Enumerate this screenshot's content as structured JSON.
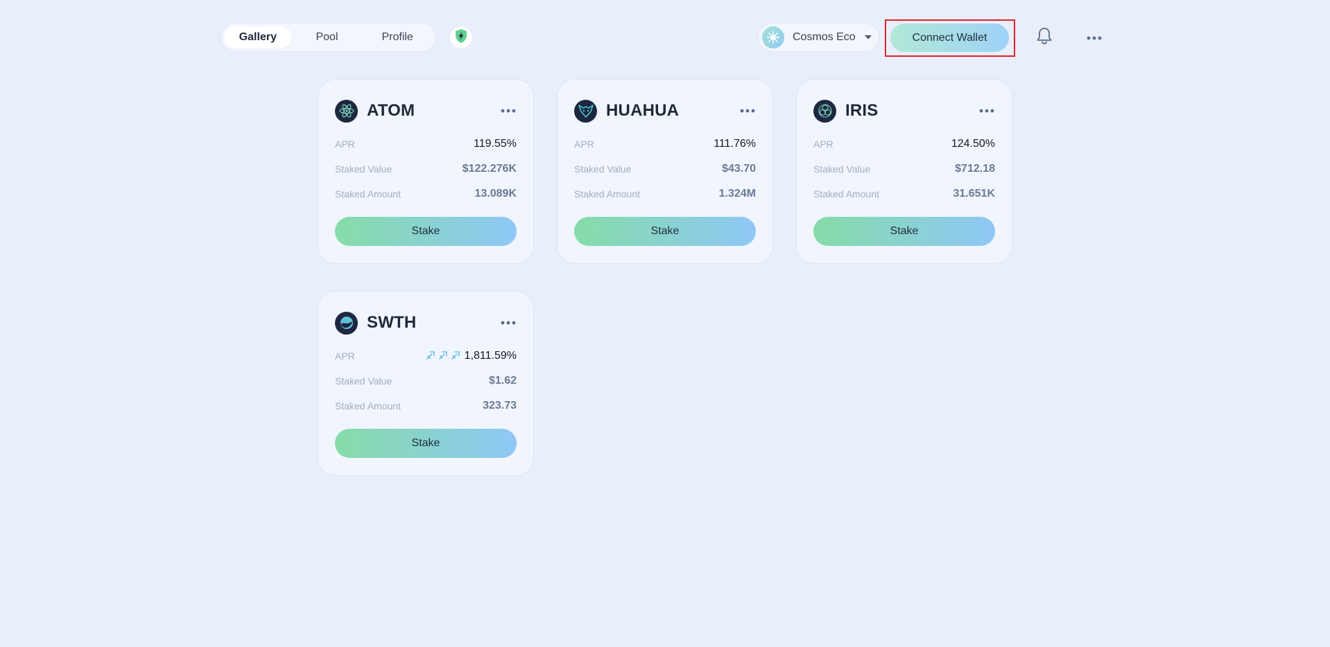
{
  "header": {
    "tabs": [
      {
        "label": "Gallery",
        "active": true
      },
      {
        "label": "Pool",
        "active": false
      },
      {
        "label": "Profile",
        "active": false
      }
    ],
    "network": {
      "label": "Cosmos Eco",
      "icon": "cosmos-logo-icon"
    },
    "connect_label": "Connect Wallet",
    "bell_icon": "bell-icon",
    "more_icon": "more-horizontal-icon",
    "shield_icon": "shield-lightning-icon"
  },
  "labels": {
    "apr": "APR",
    "staked_value": "Staked Value",
    "staked_amount": "Staked Amount",
    "stake": "Stake"
  },
  "cards": [
    {
      "name": "ATOM",
      "icon": "atom-logo-icon",
      "apr": "119.55%",
      "staked_value": "$122.276K",
      "staked_amount": "13.089K"
    },
    {
      "name": "HUAHUA",
      "icon": "huahua-logo-icon",
      "apr": "111.76%",
      "staked_value": "$43.70",
      "staked_amount": "1.324M"
    },
    {
      "name": "IRIS",
      "icon": "iris-logo-icon",
      "apr": "124.50%",
      "staked_value": "$712.18",
      "staked_amount": "31.651K"
    },
    {
      "name": "SWTH",
      "icon": "swth-logo-icon",
      "apr": "1,811.59%",
      "apr_badge": "rocket-icons",
      "staked_value": "$1.62",
      "staked_amount": "323.73"
    }
  ],
  "colors": {
    "background": "#e8eefa",
    "card": "#f1f5fd",
    "highlight_outline": "#e0212b",
    "stake_gradient_start": "#86dca8",
    "stake_gradient_end": "#8fc8f7"
  }
}
